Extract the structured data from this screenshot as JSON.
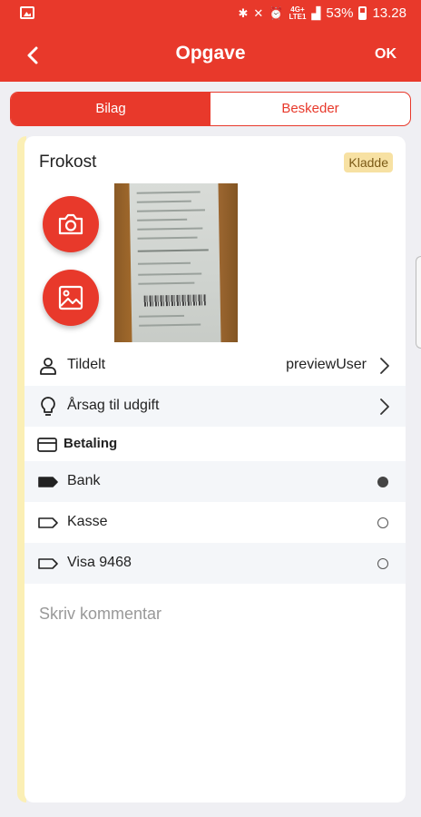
{
  "status_bar": {
    "battery": "53%",
    "time": "13.28",
    "network_top": "4G+",
    "network_bottom": "LTE1"
  },
  "app_bar": {
    "title": "Opgave",
    "ok_label": "OK"
  },
  "tabs": [
    {
      "label": "Bilag",
      "active": true
    },
    {
      "label": "Beskeder",
      "active": false
    }
  ],
  "card": {
    "title": "Frokost",
    "badge": "Kladde",
    "assigned": {
      "label": "Tildelt",
      "value": "previewUser"
    },
    "reason": {
      "label": "Årsag til udgift"
    },
    "payment": {
      "label": "Betaling",
      "options": [
        {
          "label": "Bank",
          "selected": true
        },
        {
          "label": "Kasse",
          "selected": false
        },
        {
          "label": "Visa 9468",
          "selected": false
        }
      ]
    },
    "comment_placeholder": "Skriv kommentar"
  },
  "colors": {
    "brand": "#e8392b",
    "badge_bg": "#f7e1a3",
    "draft_stripe": "#fbefb5"
  },
  "icons": [
    "image-icon",
    "bluetooth-icon",
    "mute-icon",
    "alarm-icon",
    "wifi-icon",
    "signal-icon",
    "battery-icon",
    "back-arrow-icon",
    "camera-icon",
    "gallery-icon",
    "person-icon",
    "lightbulb-icon",
    "card-icon",
    "tag-icon",
    "chevron-right-icon"
  ]
}
